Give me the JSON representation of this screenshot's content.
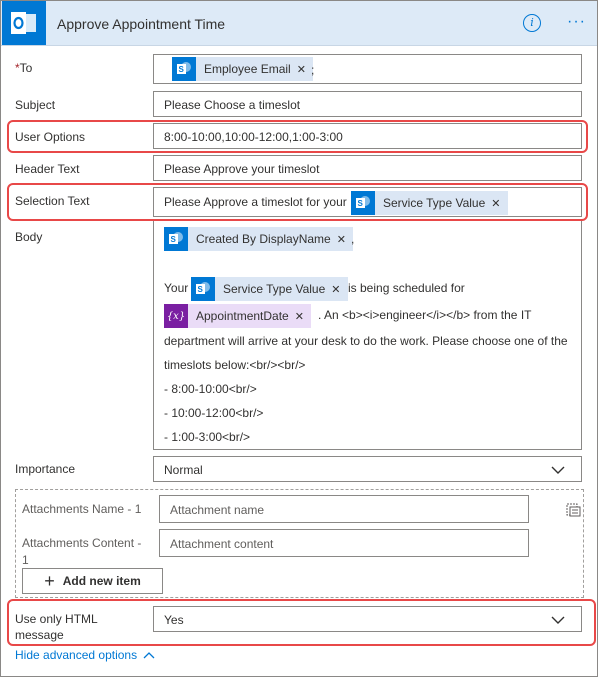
{
  "header": {
    "title": "Approve Appointment Time",
    "more": "···",
    "info": "i"
  },
  "to": {
    "label": "To",
    "required_mark": "*",
    "token": "Employee Email",
    "separator": ";"
  },
  "subject": {
    "label": "Subject",
    "value": "Please Choose a timeslot"
  },
  "user_options": {
    "label": "User Options",
    "value": "8:00-10:00,10:00-12:00,1:00-3:00"
  },
  "header_text": {
    "label": "Header Text",
    "value": "Please Approve your timeslot"
  },
  "selection_text": {
    "label": "Selection Text",
    "value": "Please Approve a timeslot for your",
    "token": "Service Type Value"
  },
  "body": {
    "label": "Body",
    "token1": "Created By DisplayName",
    "comma": ",",
    "line_your": "Your",
    "token2": "Service Type Value",
    "line_sched": "is being scheduled for",
    "token3": "AppointmentDate",
    "line_an": ". An <b><i>engineer</i></b> from the IT",
    "line_dept": "department will arrive at your desk to do the work.  Please choose one of the",
    "line_slots": "timeslots below:<br/><br/>",
    "line_1": "- 8:00-10:00<br/>",
    "line_2": "- 10:00-12:00<br/>",
    "line_3": "- 1:00-3:00<br/>"
  },
  "importance": {
    "label": "Importance",
    "value": "Normal"
  },
  "attachments": {
    "name_label": "Attachments Name - 1",
    "name_placeholder": "Attachment name",
    "content_label_1": "Attachments Content -",
    "content_label_2": "1",
    "content_placeholder": "Attachment content",
    "add_label": "Add new item"
  },
  "html_message": {
    "label_1": "Use only HTML",
    "label_2": "message",
    "value": "Yes"
  },
  "hide_advanced": "Hide advanced options",
  "colors": {
    "accent": "#0078d4",
    "highlight": "#e84848",
    "header_bg": "#ddeaf7"
  }
}
